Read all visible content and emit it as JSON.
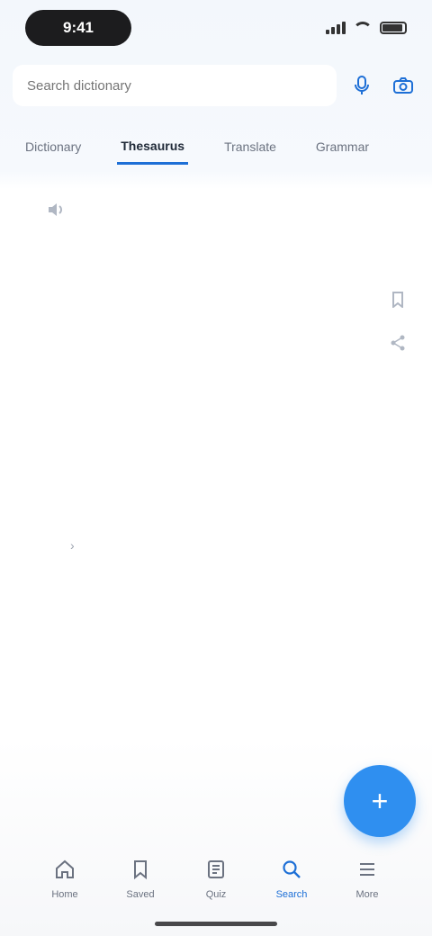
{
  "status_bar": {
    "time": "9:41"
  },
  "search": {
    "value": "",
    "placeholder": "Search dictionary",
    "mic_icon": "mic-icon",
    "camera_icon": "camera-icon"
  },
  "tabs": [
    {
      "label": "Dictionary",
      "active": false
    },
    {
      "label": "Thesaurus",
      "active": true
    },
    {
      "label": "Translate",
      "active": false
    },
    {
      "label": "Grammar",
      "active": false
    }
  ],
  "entry": {
    "word": "",
    "word_suffix": "",
    "pronunciation": "",
    "part_of_speech": "",
    "definition": "",
    "examples": [
      "",
      "",
      ""
    ],
    "links": [
      "",
      ""
    ]
  },
  "nav": [
    {
      "label": "Home",
      "icon": "home-icon",
      "active": false
    },
    {
      "label": "Saved",
      "icon": "bookmark-icon",
      "active": false
    },
    {
      "label": "Quiz",
      "icon": "quiz-icon",
      "active": false
    },
    {
      "label": "Search",
      "icon": "search-icon",
      "active": true
    },
    {
      "label": "More",
      "icon": "menu-icon",
      "active": false
    }
  ],
  "colors": {
    "accent": "#1d6fd6",
    "fab": "#2f8ff0"
  }
}
